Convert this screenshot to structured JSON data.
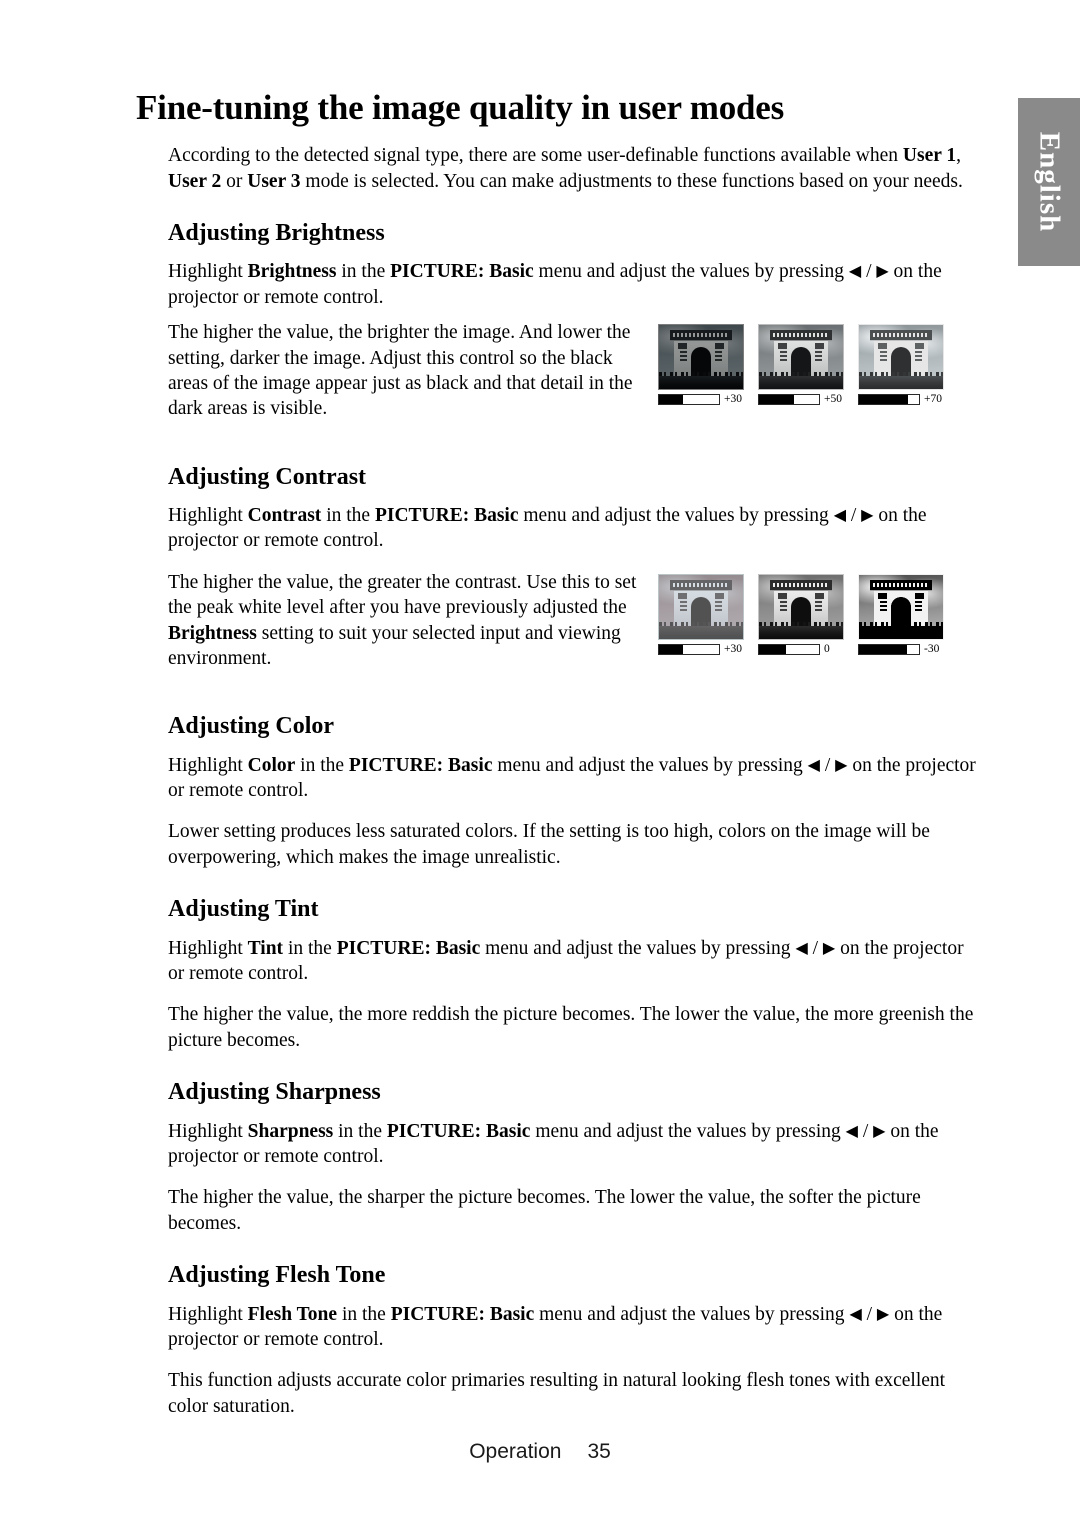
{
  "language_tab": {
    "label": "English",
    "background": "#8a8a8a",
    "text_color": "#ffffff"
  },
  "title": "Fine-tuning the image quality in user modes",
  "intro": {
    "part1": "According to the detected signal type, there are some user-definable functions available when ",
    "b1": "User 1",
    "sep1": ", ",
    "b2": "User 2",
    "sep2": " or ",
    "b3": "User 3",
    "part2": " mode is selected. You can make adjustments to these functions based on your needs."
  },
  "sections": {
    "brightness": {
      "heading": "Adjusting Brightness",
      "instr_pre": "Highlight ",
      "instr_setting": "Brightness",
      "instr_mid": " in the ",
      "instr_menu": "PICTURE: Basic",
      "instr_post": " menu and adjust the values by pressing ",
      "instr_tail": " on the projector or remote control.",
      "desc": "The higher the value, the brighter the image. And lower the setting, darker the image. Adjust this control so the black areas of the image appear just as black and that detail in the dark areas is visible.",
      "thumbnails": [
        {
          "value_label": "+30",
          "fill_percent": 40,
          "variant": "v-b30"
        },
        {
          "value_label": "+50",
          "fill_percent": 58,
          "variant": "v-b50"
        },
        {
          "value_label": "+70",
          "fill_percent": 82,
          "variant": "v-b70"
        }
      ]
    },
    "contrast": {
      "heading": "Adjusting Contrast",
      "instr_pre": "Highlight ",
      "instr_setting": "Contrast",
      "instr_mid": " in the ",
      "instr_menu": "PICTURE: Basic",
      "instr_post": " menu and adjust the values by pressing ",
      "instr_tail": " on the projector or remote control.",
      "desc_part1": "The higher the value, the greater the contrast. Use this to set the peak white level after you have previously adjusted the ",
      "desc_bold": "Brightness",
      "desc_part2": " setting to suit your selected input and viewing environment.",
      "thumbnails": [
        {
          "value_label": "+30",
          "fill_percent": 40,
          "variant": "v-c30"
        },
        {
          "value_label": "0",
          "fill_percent": 45,
          "variant": "v-c0"
        },
        {
          "value_label": "-30",
          "fill_percent": 80,
          "variant": "v-cm30"
        }
      ]
    },
    "color": {
      "heading": "Adjusting Color",
      "instr_pre": "Highlight ",
      "instr_setting": "Color",
      "instr_mid": " in the ",
      "instr_menu": "PICTURE: Basic",
      "instr_post": " menu and adjust the values by pressing ",
      "instr_tail": " on the projector or remote control.",
      "desc": "Lower setting produces less saturated colors. If the setting is too high, colors on the image will be overpowering, which makes the image unrealistic."
    },
    "tint": {
      "heading": "Adjusting Tint",
      "instr_pre": "Highlight ",
      "instr_setting": "Tint",
      "instr_mid": " in the ",
      "instr_menu": "PICTURE: Basic",
      "instr_post": " menu and adjust the values by pressing ",
      "instr_tail": " on the projector or remote control.",
      "desc": "The higher the value, the more reddish the picture becomes. The lower the value, the more greenish the picture becomes."
    },
    "sharpness": {
      "heading": "Adjusting Sharpness",
      "instr_pre": "Highlight ",
      "instr_setting": "Sharpness",
      "instr_mid": " in the ",
      "instr_menu": "PICTURE: Basic",
      "instr_post": " menu and adjust the values by pressing ",
      "instr_tail": " on the projector or remote control.",
      "desc": "The higher the value, the sharper the picture becomes. The lower the value, the softer the picture becomes."
    },
    "flesh_tone": {
      "heading": "Adjusting Flesh Tone",
      "instr_pre": "Highlight ",
      "instr_setting": "Flesh Tone",
      "instr_mid": " in the ",
      "instr_menu": "PICTURE: Basic",
      "instr_post": " menu and adjust the values by pressing ",
      "instr_tail": " on the projector or remote control.",
      "desc": "This function adjusts accurate color primaries resulting in natural looking flesh tones with excellent color saturation."
    }
  },
  "icons": {
    "left_arrow": "◀",
    "right_arrow": "▶",
    "slash": " / "
  },
  "footer": {
    "label": "Operation",
    "page_number": "35"
  }
}
